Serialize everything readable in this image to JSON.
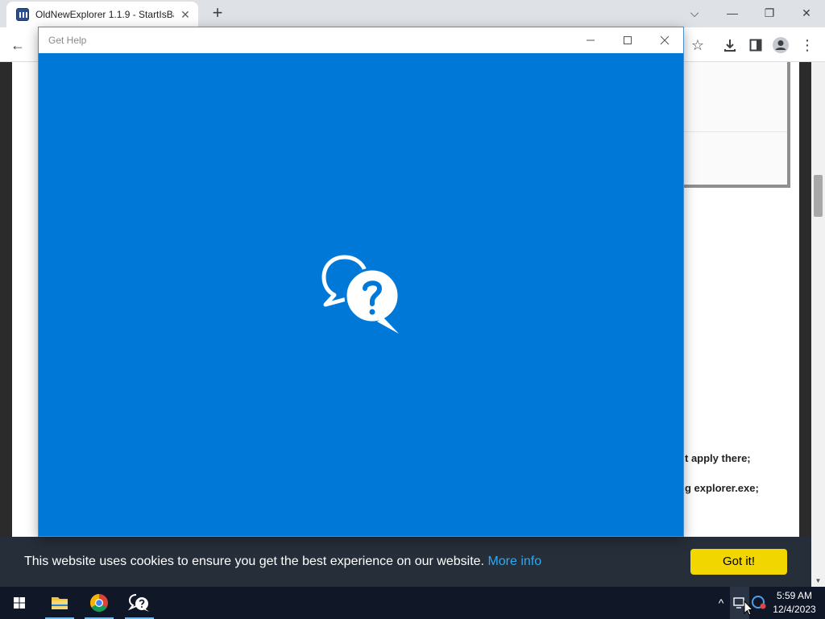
{
  "browser": {
    "tab": {
      "title": "OldNewExplorer 1.1.9 - StartIsBa",
      "close": "✕"
    },
    "new_tab": "+",
    "window_controls": {
      "dropdown": "⌵",
      "minimize": "—",
      "restore": "❐",
      "close": "✕"
    },
    "toolbar": {
      "back": "←",
      "bookmark": "☆",
      "download": "⤓",
      "menu": "⋮"
    }
  },
  "page": {
    "text_lines": [
      "t apply there;",
      "g explorer.exe;"
    ]
  },
  "help_window": {
    "title": "Get Help",
    "controls": {
      "minimize": "—",
      "maximize": "☐",
      "close": "✕"
    },
    "logo": "get-help-chat-bubbles"
  },
  "cookie_bar": {
    "message": "This website uses cookies to ensure you get the best experience on our website.",
    "link": "More info",
    "button": "Got it!"
  },
  "taskbar": {
    "apps": [
      "start",
      "file-explorer",
      "chrome",
      "get-help"
    ],
    "tray": {
      "chevron": "^"
    },
    "clock": {
      "time": "5:59 AM",
      "date": "12/4/2023"
    }
  },
  "colors": {
    "help_blue": "#0078d7",
    "cookie_bg": "#252e39",
    "cookie_button": "#f1d600",
    "cookie_link": "#31a8f0",
    "taskbar_bg": "#101828"
  }
}
